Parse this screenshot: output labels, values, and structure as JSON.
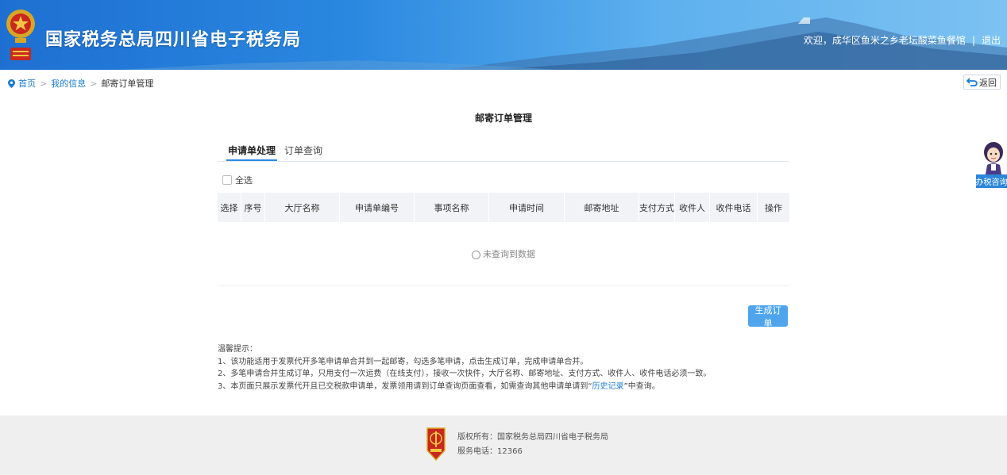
{
  "header": {
    "site_title": "国家税务总局四川省电子税务局",
    "welcome_text": "欢迎，成华区鱼米之乡老坛酸菜鱼餐馆",
    "separator": "|",
    "logout_label": "退出"
  },
  "breadcrumb": {
    "home": "首页",
    "my_info": "我的信息",
    "current": "邮寄订单管理",
    "sep": ">"
  },
  "back_button": {
    "label": "返回"
  },
  "page_title": "邮寄订单管理",
  "tabs": [
    {
      "label": "申请单处理",
      "active": true
    },
    {
      "label": "订单查询",
      "active": false
    }
  ],
  "select_all_label": "全选",
  "table": {
    "columns": [
      "选择",
      "序号",
      "大厅名称",
      "申请单编号",
      "事项名称",
      "申请时间",
      "邮寄地址",
      "支付方式",
      "收件人",
      "收件电话",
      "操作"
    ],
    "rows": [],
    "empty_text": "未查询到数据"
  },
  "generate_button": {
    "label": "生成订单"
  },
  "tips": {
    "title": "温馨提示：",
    "line1": "1、该功能适用于发票代开多笔申请单合并到一起邮寄，勾选多笔申请，点击生成订单，完成申请单合并。",
    "line2": "2、多笔申请合并生成订单，只用支付一次运费（在线支付），接收一次快件，大厅名称、邮寄地址、支付方式、收件人、收件电话必须一致。",
    "line3_before": "3、本页面只展示发票代开且已交税款申请单，发票领用请到订单查询页面查看，如需查询其他申请单请到“",
    "line3_link": "历史记录",
    "line3_after": "”中查询。"
  },
  "footer": {
    "copyright": "版权所有：国家税务总局四川省电子税务局",
    "phone": "服务电话：12366"
  },
  "consult_widget": {
    "label": "办税咨询"
  },
  "colors": {
    "header_blue": "#2a88e0",
    "link_blue": "#1a7bd4",
    "button_blue": "#4ea5ee",
    "footer_bg": "#efefef"
  },
  "icons": [
    "emblem-logo",
    "location-pin-icon",
    "back-arrow-icon",
    "checkbox-icon",
    "empty-circle-icon",
    "footer-logo",
    "consult-avatar-icon"
  ]
}
